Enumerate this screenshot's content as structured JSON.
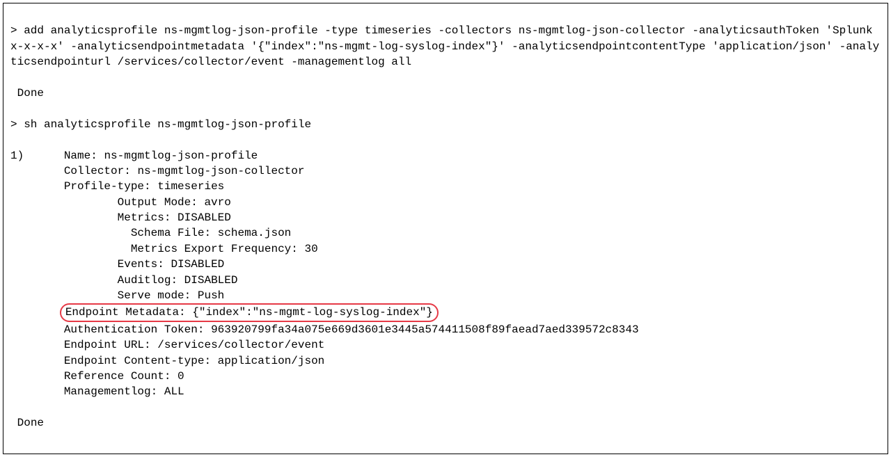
{
  "cmd1_prompt": "> ",
  "cmd1": "add analyticsprofile ns-mgmtlog-json-profile -type timeseries -collectors ns-mgmtlog-json-collector -analyticsauthToken 'Splunk x-x-x-x' -analyticsendpointmetadata '{\"index\":\"ns-mgmt-log-syslog-index\"}' -analyticsendpointcontentType 'application/json' -analyticsendpointurl /services/collector/event -managementlog all",
  "cmd1_result": " Done",
  "cmd2_prompt": "> ",
  "cmd2": "sh analyticsprofile ns-mgmtlog-json-profile",
  "out_index": "1)",
  "profile": {
    "name_label": "Name:",
    "name_value": "ns-mgmtlog-json-profile",
    "collector_label": "Collector:",
    "collector_value": "ns-mgmtlog-json-collector",
    "profiletype_label": "Profile-type:",
    "profiletype_value": "timeseries",
    "outputmode_label": "Output Mode:",
    "outputmode_value": "avro",
    "metrics_label": "Metrics:",
    "metrics_value": "DISABLED",
    "schemafile_label": "Schema File:",
    "schemafile_value": "schema.json",
    "metricsfreq_label": "Metrics Export Frequency:",
    "metricsfreq_value": "30",
    "events_label": "Events:",
    "events_value": "DISABLED",
    "auditlog_label": "Auditlog:",
    "auditlog_value": "DISABLED",
    "servemode_label": "Serve mode:",
    "servemode_value": "Push",
    "endpointmeta_label": "Endpoint Metadata:",
    "endpointmeta_value": "{\"index\":\"ns-mgmt-log-syslog-index\"}",
    "authtoken_label": "Authentication Token:",
    "authtoken_value": "963920799fa34a075e669d3601e3445a574411508f89faead7aed339572c8343",
    "endpointurl_label": "Endpoint URL:",
    "endpointurl_value": "/services/collector/event",
    "endpointct_label": "Endpoint Content-type:",
    "endpointct_value": "application/json",
    "refcount_label": "Reference Count:",
    "refcount_value": "0",
    "mgmtlog_label": "Managementlog:",
    "mgmtlog_value": "ALL"
  },
  "done": " Done"
}
